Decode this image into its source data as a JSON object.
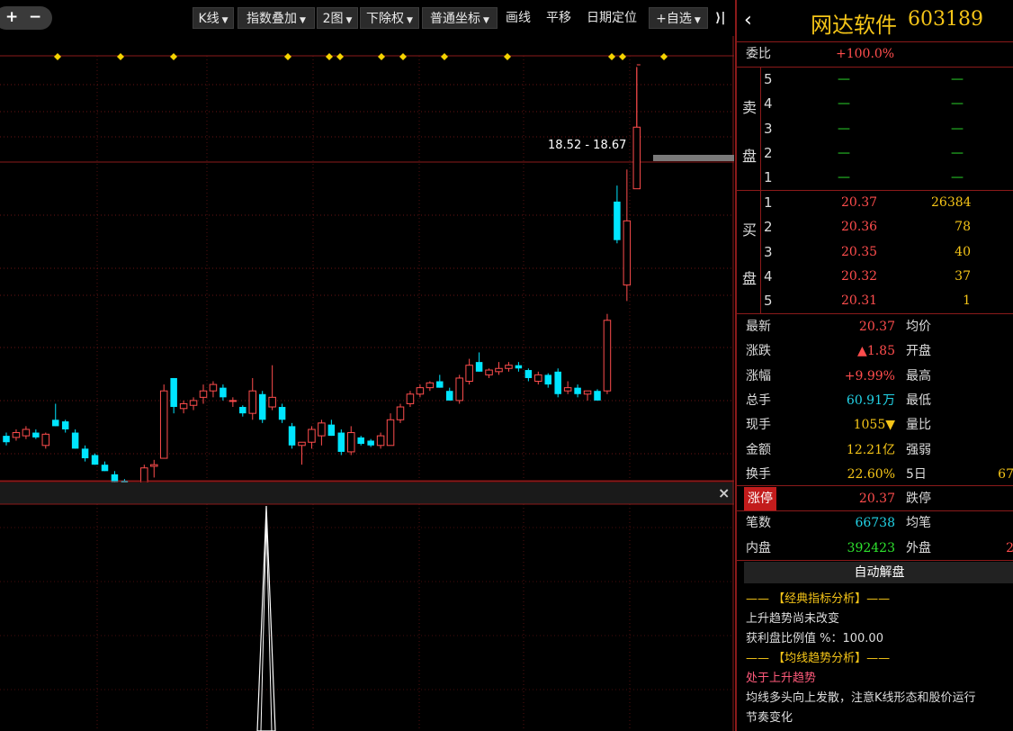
{
  "toolbar": {
    "plus": "+",
    "minus": "−",
    "kline": "K线",
    "index_overlay": "指数叠加",
    "two_charts": "2图",
    "adjust": "下除权",
    "coord": "普通坐标",
    "draw": "画线",
    "pan": "平移",
    "date_locate": "日期定位",
    "add_fav": "+自选",
    "collapse": "⟩|"
  },
  "chart": {
    "price_range_label": "18.52 - 18.67",
    "close_icon": "×",
    "colors": {
      "up": "#ff4d4d",
      "down": "#00e5ff",
      "marker": "#f5d300",
      "grid": "#8b1a1a"
    }
  },
  "chart_data": {
    "type": "candlestick",
    "ylim": [
      7.5,
      20.8
    ],
    "candles": [
      {
        "o": 8.9,
        "h": 9.0,
        "l": 8.6,
        "c": 8.7
      },
      {
        "o": 8.85,
        "h": 9.1,
        "l": 8.75,
        "c": 9.0
      },
      {
        "o": 8.9,
        "h": 9.2,
        "l": 8.8,
        "c": 9.1
      },
      {
        "o": 9.0,
        "h": 9.1,
        "l": 8.8,
        "c": 8.85
      },
      {
        "o": 8.6,
        "h": 9.0,
        "l": 8.5,
        "c": 8.95
      },
      {
        "o": 9.4,
        "h": 9.9,
        "l": 9.2,
        "c": 9.2
      },
      {
        "o": 9.35,
        "h": 9.4,
        "l": 9.0,
        "c": 9.1
      },
      {
        "o": 9.0,
        "h": 9.1,
        "l": 8.5,
        "c": 8.5
      },
      {
        "o": 8.5,
        "h": 8.6,
        "l": 8.1,
        "c": 8.2
      },
      {
        "o": 8.3,
        "h": 8.35,
        "l": 8.0,
        "c": 8.0
      },
      {
        "o": 8.0,
        "h": 8.1,
        "l": 7.8,
        "c": 7.8
      },
      {
        "o": 7.7,
        "h": 7.8,
        "l": 7.45,
        "c": 7.45
      },
      {
        "o": 7.5,
        "h": 7.55,
        "l": 7.35,
        "c": 7.35
      },
      {
        "o": 7.3,
        "h": 7.35,
        "l": 7.25,
        "c": 7.25
      },
      {
        "o": 7.2,
        "h": 8.0,
        "l": 7.15,
        "c": 7.9
      },
      {
        "o": 7.95,
        "h": 8.15,
        "l": 7.6,
        "c": 8.0
      },
      {
        "o": 8.2,
        "h": 10.5,
        "l": 8.2,
        "c": 10.3
      },
      {
        "o": 10.7,
        "h": 10.7,
        "l": 9.6,
        "c": 9.8
      },
      {
        "o": 9.75,
        "h": 10.0,
        "l": 9.6,
        "c": 9.9
      },
      {
        "o": 9.85,
        "h": 10.1,
        "l": 9.7,
        "c": 10.0
      },
      {
        "o": 10.1,
        "h": 10.5,
        "l": 9.9,
        "c": 10.3
      },
      {
        "o": 10.3,
        "h": 10.6,
        "l": 10.1,
        "c": 10.5
      },
      {
        "o": 10.4,
        "h": 10.5,
        "l": 10.0,
        "c": 10.1
      },
      {
        "o": 10.0,
        "h": 10.1,
        "l": 9.8,
        "c": 10.0
      },
      {
        "o": 9.8,
        "h": 9.85,
        "l": 9.5,
        "c": 9.6
      },
      {
        "o": 9.6,
        "h": 10.7,
        "l": 9.4,
        "c": 10.3
      },
      {
        "o": 10.2,
        "h": 10.3,
        "l": 9.3,
        "c": 9.4
      },
      {
        "o": 9.8,
        "h": 11.1,
        "l": 9.7,
        "c": 10.1
      },
      {
        "o": 9.8,
        "h": 9.9,
        "l": 9.3,
        "c": 9.4
      },
      {
        "o": 9.2,
        "h": 9.3,
        "l": 8.5,
        "c": 8.6
      },
      {
        "o": 8.6,
        "h": 8.7,
        "l": 8.0,
        "c": 8.7
      },
      {
        "o": 8.7,
        "h": 9.2,
        "l": 8.5,
        "c": 9.1
      },
      {
        "o": 8.9,
        "h": 9.4,
        "l": 8.6,
        "c": 9.3
      },
      {
        "o": 9.25,
        "h": 9.4,
        "l": 8.9,
        "c": 8.9
      },
      {
        "o": 9.0,
        "h": 9.1,
        "l": 8.3,
        "c": 8.4
      },
      {
        "o": 8.4,
        "h": 9.2,
        "l": 8.3,
        "c": 9.0
      },
      {
        "o": 8.85,
        "h": 8.9,
        "l": 8.6,
        "c": 8.65
      },
      {
        "o": 8.75,
        "h": 8.8,
        "l": 8.55,
        "c": 8.6
      },
      {
        "o": 8.6,
        "h": 9.0,
        "l": 8.5,
        "c": 8.9
      },
      {
        "o": 8.6,
        "h": 9.6,
        "l": 8.6,
        "c": 9.4
      },
      {
        "o": 9.4,
        "h": 9.9,
        "l": 9.3,
        "c": 9.8
      },
      {
        "o": 9.9,
        "h": 10.3,
        "l": 9.8,
        "c": 10.2
      },
      {
        "o": 10.2,
        "h": 10.5,
        "l": 10.1,
        "c": 10.4
      },
      {
        "o": 10.4,
        "h": 10.6,
        "l": 10.3,
        "c": 10.55
      },
      {
        "o": 10.6,
        "h": 10.8,
        "l": 10.4,
        "c": 10.4
      },
      {
        "o": 10.3,
        "h": 10.4,
        "l": 10.0,
        "c": 10.0
      },
      {
        "o": 10.0,
        "h": 10.8,
        "l": 9.9,
        "c": 10.7
      },
      {
        "o": 10.6,
        "h": 11.3,
        "l": 10.5,
        "c": 11.1
      },
      {
        "o": 11.2,
        "h": 11.5,
        "l": 10.9,
        "c": 10.9
      },
      {
        "o": 10.8,
        "h": 11.0,
        "l": 10.7,
        "c": 10.95
      },
      {
        "o": 10.9,
        "h": 11.2,
        "l": 10.8,
        "c": 11.0
      },
      {
        "o": 11.0,
        "h": 11.2,
        "l": 10.9,
        "c": 11.1
      },
      {
        "o": 11.1,
        "h": 11.2,
        "l": 10.9,
        "c": 11.0
      },
      {
        "o": 10.95,
        "h": 11.0,
        "l": 10.6,
        "c": 10.7
      },
      {
        "o": 10.6,
        "h": 10.9,
        "l": 10.5,
        "c": 10.8
      },
      {
        "o": 10.8,
        "h": 10.85,
        "l": 10.4,
        "c": 10.5
      },
      {
        "o": 10.9,
        "h": 11.0,
        "l": 10.1,
        "c": 10.2
      },
      {
        "o": 10.3,
        "h": 10.6,
        "l": 10.2,
        "c": 10.4
      },
      {
        "o": 10.4,
        "h": 10.5,
        "l": 10.1,
        "c": 10.2
      },
      {
        "o": 10.2,
        "h": 10.3,
        "l": 10.0,
        "c": 10.3
      },
      {
        "o": 10.3,
        "h": 10.35,
        "l": 10.0,
        "c": 10.0
      },
      {
        "o": 10.3,
        "h": 12.7,
        "l": 10.2,
        "c": 12.5
      },
      {
        "o": 16.2,
        "h": 16.7,
        "l": 14.9,
        "c": 15.0
      },
      {
        "o": 13.6,
        "h": 17.2,
        "l": 13.1,
        "c": 15.6
      },
      {
        "o": 16.6,
        "h": 20.37,
        "l": 16.6,
        "c": 18.52
      }
    ],
    "volume_peak_at": 35
  },
  "quote": {
    "title_name": "网达软件",
    "title_code": "603189",
    "back": "‹",
    "weibi_label": "委比",
    "weibi_value": "+100.0%",
    "sell_label": [
      "卖",
      "盘"
    ],
    "buy_label": [
      "买",
      "盘"
    ],
    "asks": [
      {
        "lvl": "5",
        "price": "—",
        "vol": "—"
      },
      {
        "lvl": "4",
        "price": "—",
        "vol": "—"
      },
      {
        "lvl": "3",
        "price": "—",
        "vol": "—"
      },
      {
        "lvl": "2",
        "price": "—",
        "vol": "—"
      },
      {
        "lvl": "1",
        "price": "—",
        "vol": "—"
      }
    ],
    "bids": [
      {
        "lvl": "1",
        "price": "20.37",
        "vol": "26384"
      },
      {
        "lvl": "2",
        "price": "20.36",
        "vol": "78"
      },
      {
        "lvl": "3",
        "price": "20.35",
        "vol": "40"
      },
      {
        "lvl": "4",
        "price": "20.32",
        "vol": "37"
      },
      {
        "lvl": "5",
        "price": "20.31",
        "vol": "1"
      }
    ],
    "stats": [
      {
        "l1": "最新",
        "v1": "20.37",
        "c1": "red",
        "l2": "均价",
        "v2": "",
        "c2": "white"
      },
      {
        "l1": "涨跌",
        "v1": "▲1.85",
        "c1": "red",
        "l2": "开盘",
        "v2": "",
        "c2": "white"
      },
      {
        "l1": "涨幅",
        "v1": "+9.99%",
        "c1": "red",
        "l2": "最高",
        "v2": "",
        "c2": "white"
      },
      {
        "l1": "总手",
        "v1": "60.91万",
        "c1": "cyan",
        "l2": "最低",
        "v2": "",
        "c2": "white"
      },
      {
        "l1": "现手",
        "v1": "1055▼",
        "c1": "yellow",
        "l2": "量比",
        "v2": "",
        "c2": "white"
      },
      {
        "l1": "金额",
        "v1": "12.21亿",
        "c1": "yellow",
        "l2": "强弱",
        "v2": "",
        "c2": "white"
      },
      {
        "l1": "换手",
        "v1": "22.60%",
        "c1": "yellow",
        "l2": "5日",
        "v2": "67",
        "c2": "yellow"
      },
      {
        "l1": "涨停",
        "v1": "20.37",
        "c1": "red",
        "l2": "跌停",
        "v2": "",
        "c2": "white"
      },
      {
        "l1": "笔数",
        "v1": "66738",
        "c1": "cyan",
        "l2": "均笔",
        "v2": "",
        "c2": "white"
      },
      {
        "l1": "内盘",
        "v1": "392423",
        "c1": "green",
        "l2": "外盘",
        "v2": "2",
        "c2": "red"
      }
    ],
    "auto_analysis": "自动解盘",
    "analysis": [
      {
        "text": "—— 【经典指标分析】——",
        "color": "yellow"
      },
      {
        "text": "上升趋势尚未改变",
        "color": "white"
      },
      {
        "text": "获利盘比例值 %：100.00",
        "color": "white"
      },
      {
        "text": "—— 【均线趋势分析】——",
        "color": "yellow"
      },
      {
        "text": "处于上升趋势",
        "color": "red"
      },
      {
        "text": "均线多头向上发散，注意K线形态和股价运行",
        "color": "white"
      },
      {
        "text": "节奏变化",
        "color": "white"
      }
    ]
  }
}
